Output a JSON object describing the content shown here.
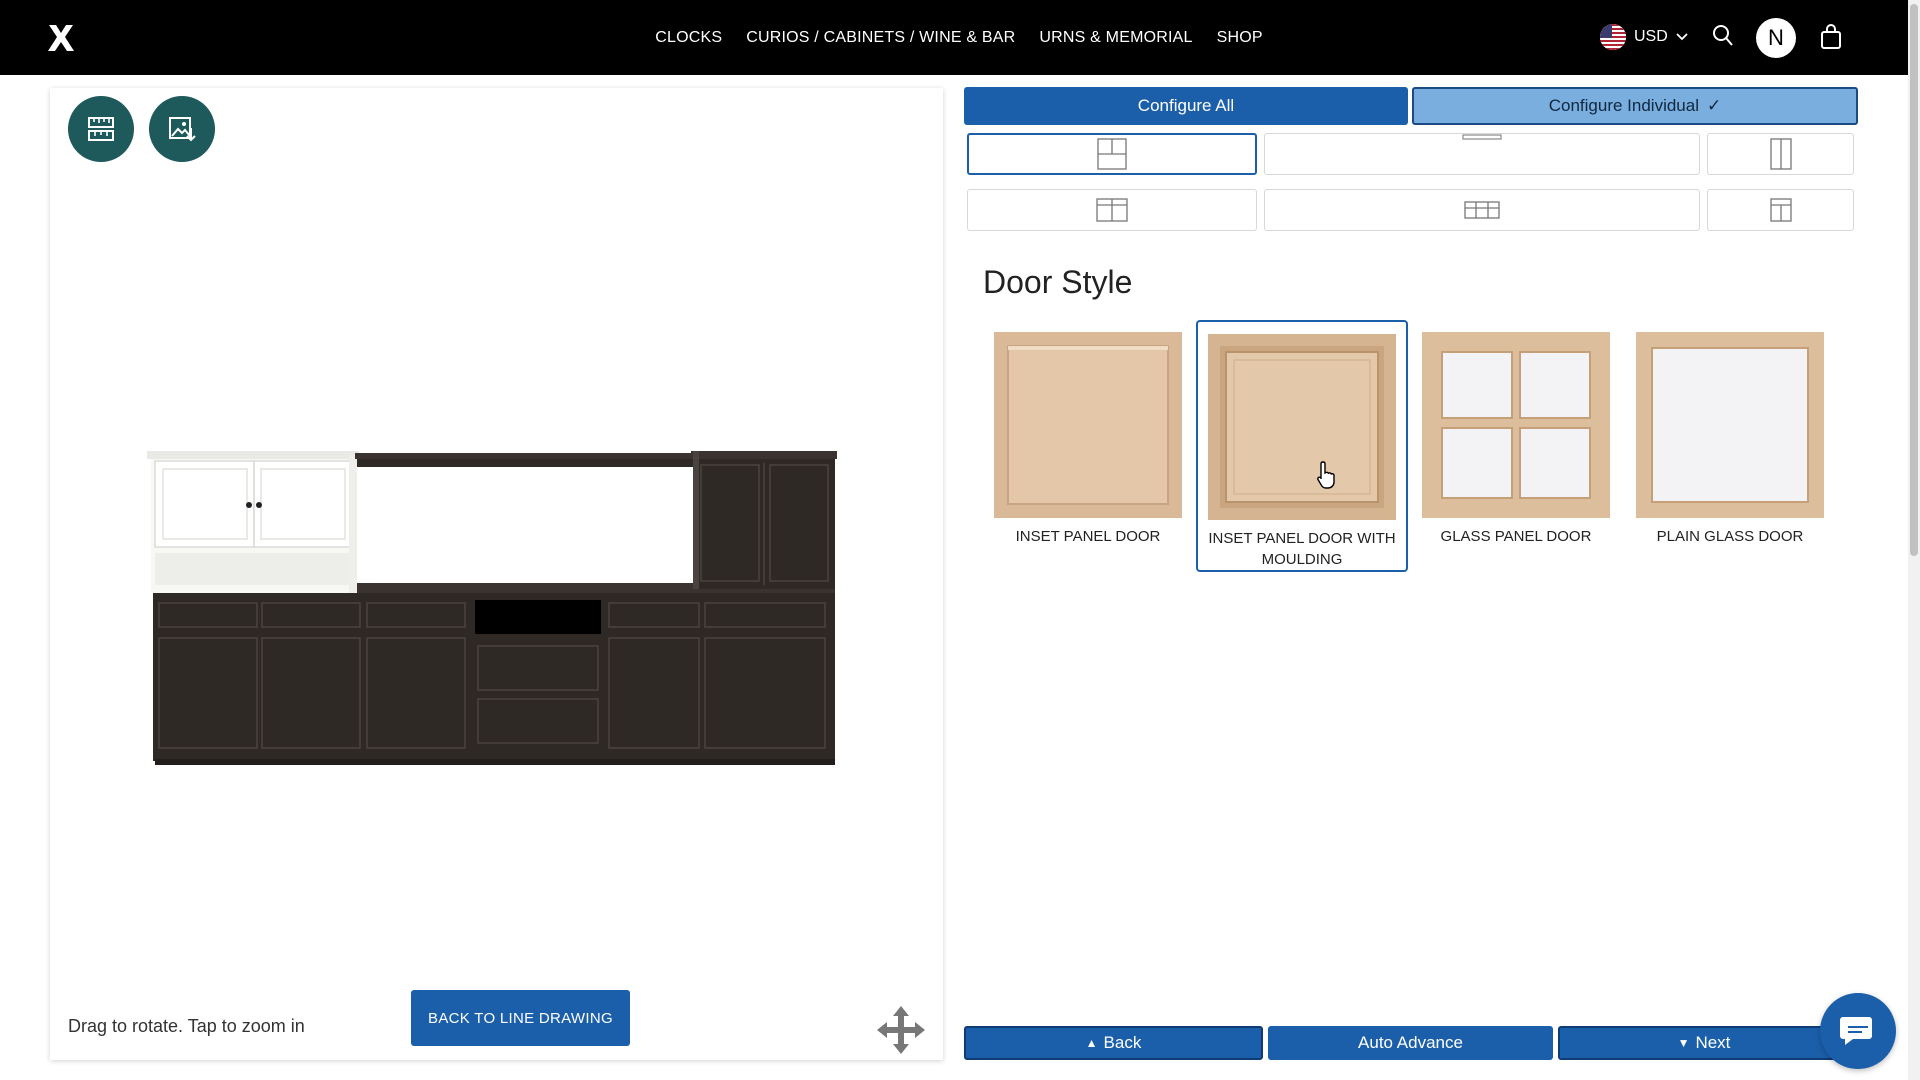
{
  "header": {
    "logo_icon": "brand-logo-icon",
    "nav": [
      "CLOCKS",
      "CURIOS / CABINETS / WINE & BAR",
      "URNS & MEMORIAL",
      "SHOP"
    ],
    "currency": "USD",
    "avatar_letter": "N"
  },
  "viewer": {
    "tool_icons": [
      "measure-icon",
      "save-image-icon"
    ],
    "caption": "Drag to rotate. Tap to zoom in",
    "back_button": "BACK TO LINE DRAWING",
    "move_icon": "move-arrows-icon"
  },
  "config": {
    "configure_all": "Configure All",
    "configure_individual": "Configure Individual",
    "configure_individual_check": "✓",
    "section_title": "Door Style",
    "door_styles": [
      {
        "label": "INSET PANEL DOOR",
        "selected": false
      },
      {
        "label": "INSET PANEL DOOR WITH MOULDING",
        "selected": true
      },
      {
        "label": "GLASS PANEL DOOR",
        "selected": false
      },
      {
        "label": "PLAIN GLASS DOOR",
        "selected": false
      }
    ]
  },
  "bottom_nav": {
    "back": "Back",
    "back_arrow": "▲",
    "auto_advance": "Auto Advance",
    "next": "Next",
    "next_arrow": "▼"
  },
  "colors": {
    "primary": "#1b5fab",
    "light_primary": "#7aaede",
    "teal": "#1e5a5c",
    "cabinet_dark": "#2f2926",
    "cabinet_white": "#f6f6f3",
    "wood": "#ddc0a0"
  }
}
